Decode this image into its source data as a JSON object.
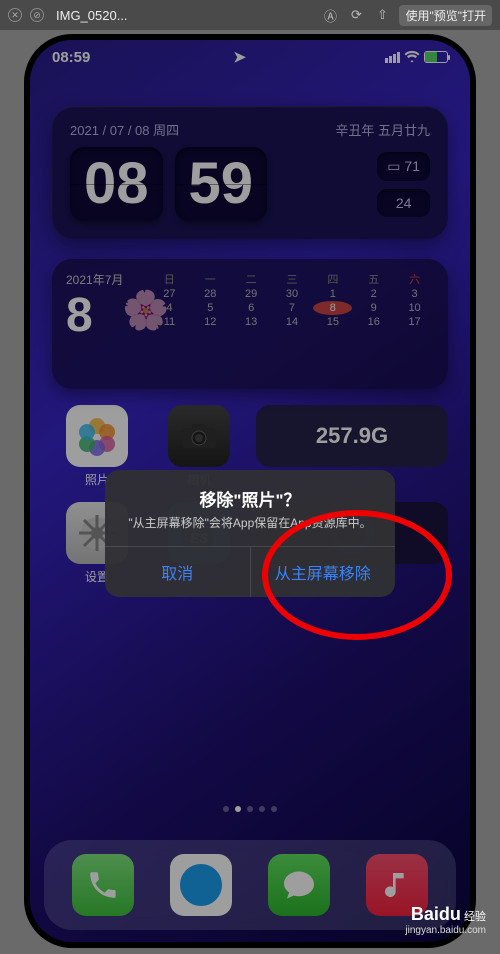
{
  "mac": {
    "title": "IMG_0520...",
    "open_btn": "使用\"预览\"打开"
  },
  "status": {
    "time": "08:59"
  },
  "clock_widget": {
    "date_left": "2021 / 07 / 08  周四",
    "date_right": "辛丑年 五月廿九",
    "hh": "08",
    "mm": "59",
    "batt_small": "71",
    "sec": "24"
  },
  "calendar": {
    "month": "2021年7月",
    "day": "8",
    "weekdays": [
      "日",
      "一",
      "二",
      "三",
      "四",
      "五",
      "六"
    ],
    "rows": [
      [
        "27",
        "28",
        "29",
        "30",
        "1",
        "2",
        "3"
      ],
      [
        "4",
        "5",
        "6",
        "7",
        "8",
        "9",
        "10"
      ],
      [
        "11",
        "12",
        "13",
        "14",
        "15",
        "16",
        "17"
      ]
    ],
    "today_value": "8"
  },
  "apps": {
    "photos": "照片",
    "camera": "相机",
    "disk_value": "257.9G",
    "settings": "设置"
  },
  "dialog": {
    "title": "移除\"照片\"？",
    "message": "\"从主屏幕移除\"会将App保留在App资源库中。",
    "cancel": "取消",
    "confirm": "从主屏幕移除"
  },
  "watermark": {
    "brand": "Baidu",
    "suffix": "经验",
    "url": "jingyan.baidu.com"
  }
}
